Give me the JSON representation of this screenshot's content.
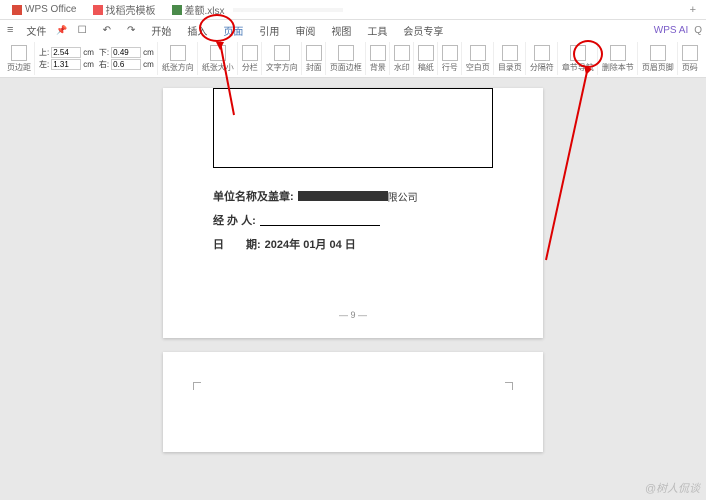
{
  "tabs": {
    "t0": "WPS Office",
    "t1": "找稻壳模板",
    "t2": "差额.xlsx",
    "plus": "+"
  },
  "menu": {
    "file": "文件",
    "items": [
      "开始",
      "插入",
      "页面",
      "引用",
      "审阅",
      "视图",
      "工具",
      "会员专享"
    ],
    "right": {
      "ai": "WPS AI",
      "search": "Q"
    }
  },
  "highlighted_menu_index": 2,
  "margins": {
    "top_label": "上:",
    "top_val": "2.54",
    "unit": "cm",
    "bottom_label": "下:",
    "bottom_val": "0.49",
    "left_label": "左:",
    "left_val": "1.31",
    "right_label": "右:",
    "right_val": "0.6"
  },
  "toolbar": {
    "page_margin": "页边距",
    "paper_dir": "纸张方向",
    "paper_size": "纸张大小",
    "columns": "分栏",
    "text_dir": "文字方向",
    "cover": "封面",
    "page_border": "页面边框",
    "background": "背景",
    "watermark": "水印",
    "gutter": "稿纸",
    "line_num": "行号",
    "blank_page": "空白页",
    "toc_page": "目录页",
    "separator": "分隔符",
    "chapter_nav": "章节导航",
    "delete_section": "删除本节",
    "header_footer": "页眉页脚",
    "page_num": "页码"
  },
  "document": {
    "org_label": "单位名称及盖章:",
    "org_suffix": "限公司",
    "handler_label": "经 办 人:",
    "date_label": "日　　期:",
    "date_value": "2024年 01月 04 日",
    "page_num": "— 9 —"
  },
  "watermark_text": "@树人侃谈"
}
